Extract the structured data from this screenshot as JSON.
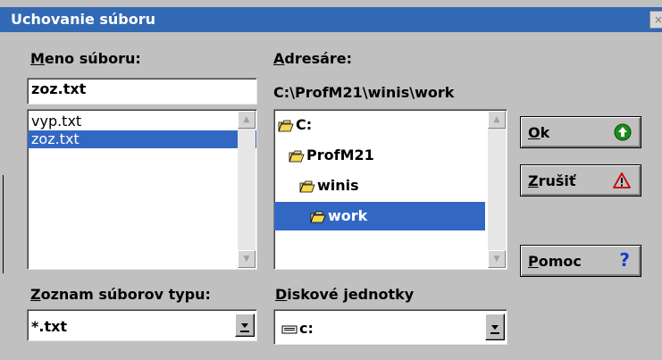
{
  "window": {
    "title": "Uchovanie súboru",
    "close_glyph": "×"
  },
  "filename": {
    "label_accel": "M",
    "label_rest": "eno súboru:",
    "value": "zoz.txt",
    "files": [
      {
        "name": "vyp.txt",
        "selected": false
      },
      {
        "name": "zoz.txt",
        "selected": true
      }
    ]
  },
  "directories": {
    "label_accel": "A",
    "label_rest": "dresáre:",
    "current_path": "C:\\ProfM21\\winis\\work",
    "items": [
      {
        "name": "C:",
        "selected": false
      },
      {
        "name": "ProfM21",
        "selected": false
      },
      {
        "name": "winis",
        "selected": false
      },
      {
        "name": "work",
        "selected": true
      }
    ]
  },
  "file_type": {
    "label_accel": "Z",
    "label_rest": "oznam súborov typu:",
    "value": "*.txt"
  },
  "drives": {
    "label_accel": "D",
    "label_rest": "iskové jednotky",
    "value": "c:"
  },
  "buttons": {
    "ok": {
      "accel": "O",
      "rest": "k"
    },
    "cancel": {
      "accel": "Z",
      "rest": "rušiť"
    },
    "help": {
      "accel": "P",
      "rest": "omoc",
      "icon_glyph": "?"
    }
  },
  "colors": {
    "titlebar": "#3269b5",
    "selection": "#3268c4",
    "ok_icon": "#1a8c1a",
    "cancel_icon": "#cc0000",
    "help_icon": "#1a3cc8"
  }
}
